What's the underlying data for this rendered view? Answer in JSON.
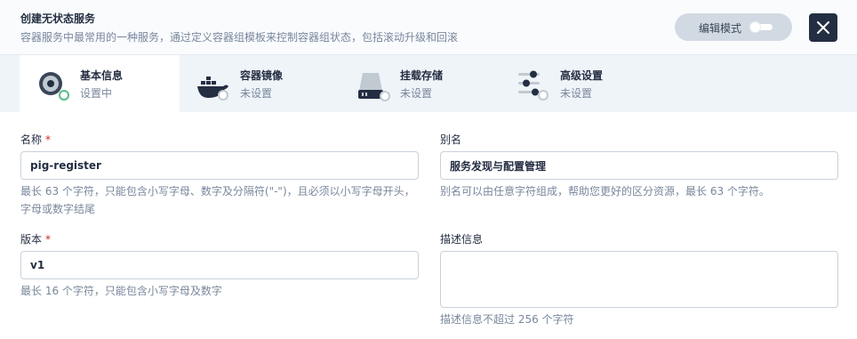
{
  "dialog": {
    "title": "创建无状态服务",
    "subtitle": "容器服务中最常用的一种服务，通过定义容器组模板来控制容器组状态，包括滚动升级和回滚",
    "edit_mode_label": "编辑模式"
  },
  "tabs": [
    {
      "name": "基本信息",
      "status": "设置中",
      "icon": "info-icon",
      "active": true
    },
    {
      "name": "容器镜像",
      "status": "未设置",
      "icon": "docker-icon",
      "active": false
    },
    {
      "name": "挂载存储",
      "status": "未设置",
      "icon": "storage-icon",
      "active": false
    },
    {
      "name": "高级设置",
      "status": "未设置",
      "icon": "sliders-icon",
      "active": false
    }
  ],
  "form": {
    "name": {
      "label": "名称",
      "required": "*",
      "value": "pig-register",
      "hint": "最长 63 个字符，只能包含小写字母、数字及分隔符(\"-\")，且必须以小写字母开头，字母或数字结尾"
    },
    "alias": {
      "label": "别名",
      "value": "服务发现与配置管理",
      "hint": "别名可以由任意字符组成，帮助您更好的区分资源，最长 63 个字符。"
    },
    "version": {
      "label": "版本",
      "required": "*",
      "value": "v1",
      "hint": "最长 16 个字符，只能包含小写字母及数字"
    },
    "description": {
      "label": "描述信息",
      "value": "",
      "hint": "描述信息不超过 256 个字符"
    }
  },
  "colors": {
    "primary_dark": "#242e42",
    "muted_text": "#79879c",
    "required": "#ca2621",
    "status_active": "#55bc8a",
    "tab_bar_bg": "#eff4f9"
  }
}
